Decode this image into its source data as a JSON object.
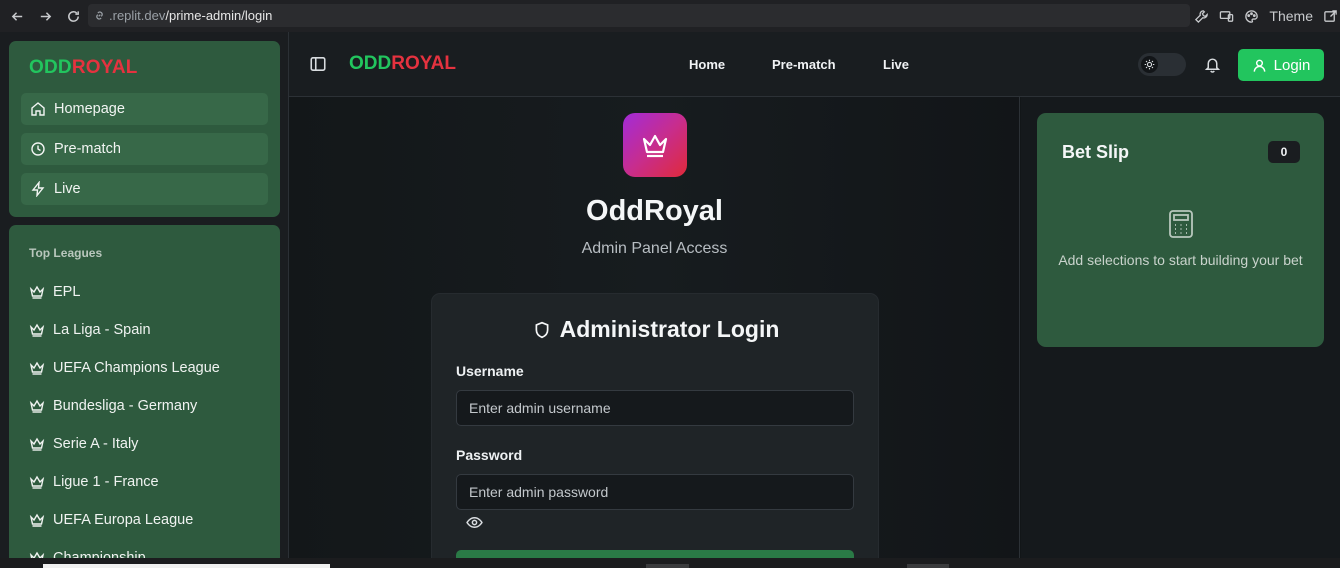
{
  "browser": {
    "url_host": ".replit.dev",
    "url_path": "/prime-admin/login",
    "theme_label": "Theme"
  },
  "sidebar": {
    "brand_part1": "ODD",
    "brand_part2": "ROYAL",
    "nav": [
      {
        "label": "Homepage",
        "icon": "home-icon"
      },
      {
        "label": "Pre-match",
        "icon": "clock-icon"
      },
      {
        "label": "Live",
        "icon": "lightning-icon"
      }
    ],
    "leagues_title": "Top Leagues",
    "leagues": [
      "EPL",
      "La Liga - Spain",
      "UEFA Champions League",
      "Bundesliga - Germany",
      "Serie A - Italy",
      "Ligue 1 - France",
      "UEFA Europa League",
      "Championship"
    ]
  },
  "header": {
    "brand_part1": "ODD",
    "brand_part2": "ROYAL",
    "links": [
      "Home",
      "Pre-match",
      "Live"
    ],
    "login_label": "Login"
  },
  "main": {
    "title": "OddRoyal",
    "subtitle": "Admin Panel Access",
    "card_title": "Administrator Login",
    "username_label": "Username",
    "username_placeholder": "Enter admin username",
    "password_label": "Password",
    "password_placeholder": "Enter admin password"
  },
  "betslip": {
    "title": "Bet Slip",
    "count": "0",
    "empty_text": "Add selections to start building your bet"
  },
  "colors": {
    "brand_green": "#22c55e",
    "brand_red": "#e5323f",
    "card_green": "#2e5a3e"
  }
}
